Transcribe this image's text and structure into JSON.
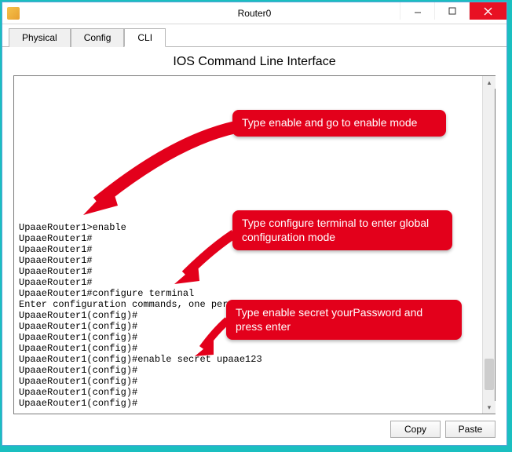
{
  "window": {
    "title": "Router0"
  },
  "tabs": {
    "physical": "Physical",
    "config": "Config",
    "cli": "CLI"
  },
  "panel_title": "IOS Command Line Interface",
  "terminal_lines": [
    "",
    "",
    "",
    "",
    "",
    "",
    "",
    "",
    "",
    "",
    "",
    "",
    "",
    "UpaaeRouter1>enable",
    "UpaaeRouter1#",
    "UpaaeRouter1#",
    "UpaaeRouter1#",
    "UpaaeRouter1#",
    "UpaaeRouter1#",
    "UpaaeRouter1#configure terminal",
    "Enter configuration commands, one per line.  End with CNTL/Z.",
    "UpaaeRouter1(config)#",
    "UpaaeRouter1(config)#",
    "UpaaeRouter1(config)#",
    "UpaaeRouter1(config)#",
    "UpaaeRouter1(config)#enable secret upaae123",
    "UpaaeRouter1(config)#",
    "UpaaeRouter1(config)#",
    "UpaaeRouter1(config)#",
    "UpaaeRouter1(config)#"
  ],
  "buttons": {
    "copy": "Copy",
    "paste": "Paste"
  },
  "callouts": {
    "c1": "Type enable and go to enable mode",
    "c2": "Type configure terminal to enter global configuration mode",
    "c3": "Type enable secret yourPassword and press enter"
  }
}
